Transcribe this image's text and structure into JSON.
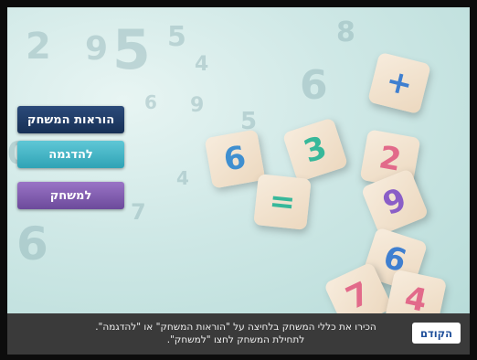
{
  "menu": {
    "rules_label": "הוראות המשחק",
    "demo_label": "להדגמה",
    "game_label": "למשחק"
  },
  "footer": {
    "instructions_line1": "הכירו את כללי המשחק בלחיצה על \"הוראות המשחק\" או \"להדגמה\".",
    "instructions_line2": "לתחילת המשחק לחצו \"למשחק\".",
    "back_label": "הקודם"
  },
  "background": {
    "blocks": [
      "+",
      "6",
      "3",
      "2",
      "=",
      "9",
      "6",
      "7",
      "4"
    ]
  },
  "colors": {
    "rules_button": "#1f3b66",
    "demo_button": "#3fb4c5",
    "game_button": "#7e5aaf",
    "bottom_bar": "#3a3a3a"
  }
}
